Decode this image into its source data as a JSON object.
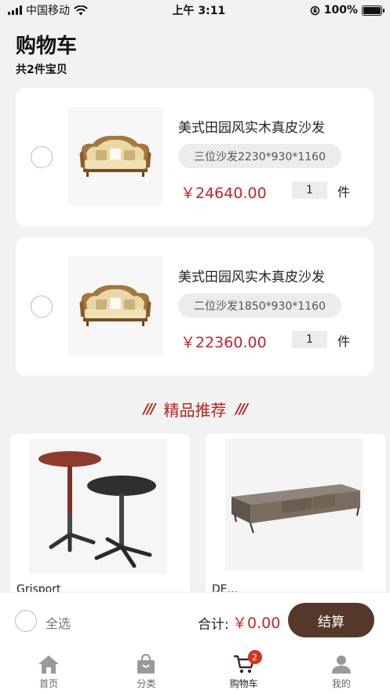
{
  "status_bar": {
    "carrier": "中国移动",
    "time": "上午 3:11",
    "battery": "100%"
  },
  "header": {
    "title": "购物车",
    "count_text": "共2件宝贝"
  },
  "cart_items": [
    {
      "name": "美式田园风实木真皮沙发",
      "spec": "三位沙发2230*930*1160",
      "price": "￥24640.00",
      "quantity": "1",
      "unit": "件",
      "image": "sofa-three-seat"
    },
    {
      "name": "美式田园风实木真皮沙发",
      "spec": "二位沙发1850*930*1160",
      "price": "￥22360.00",
      "quantity": "1",
      "unit": "件",
      "image": "sofa-two-seat"
    }
  ],
  "recommend": {
    "title": "精品推荐",
    "decoration": "///",
    "items": [
      {
        "name": "Grisport",
        "image": "side-tables"
      },
      {
        "name": "DE...",
        "image": "tv-cabinet"
      }
    ]
  },
  "checkout": {
    "select_all": "全选",
    "total_label": "合计:",
    "total_value": "￥0.00",
    "button": "结算"
  },
  "tabs": [
    {
      "label": "首页",
      "icon": "home-icon"
    },
    {
      "label": "分类",
      "icon": "bag-icon"
    },
    {
      "label": "购物车",
      "icon": "cart-icon",
      "badge": "2",
      "active": true
    },
    {
      "label": "我的",
      "icon": "user-icon"
    }
  ],
  "colors": {
    "price": "#c0262a",
    "accent": "#b3251f",
    "button": "#56382b",
    "badge": "#d7321f"
  }
}
